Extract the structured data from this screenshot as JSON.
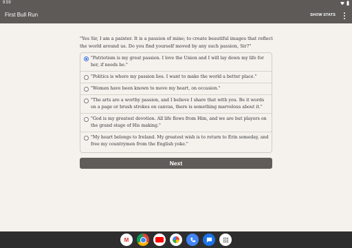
{
  "status_bar": {
    "time": "9:59"
  },
  "app_bar": {
    "title": "First Bull Run",
    "stats_label": "SHOW STATS"
  },
  "passage": "\"Yes Sir, I am a painter. It is a passion of mine; to create beautiful images that reflect the world around us. Do you find yourself moved by any such passion, Sir?\"",
  "choices": [
    {
      "text": "\"Patriotism is my great passion. I love the Union and I will lay down my life for her, if needs be.\"",
      "selected": true
    },
    {
      "text": "\"Politics is where my passion lies. I want to make the world a better place.\"",
      "selected": false
    },
    {
      "text": "\"Women have been known to move my heart, on occasion.\"",
      "selected": false
    },
    {
      "text": "\"The arts are a worthy passion, and I believe I share that with you. Be it words on a page or brush strokes on canvas, there is something marvelous about it.\"",
      "selected": false
    },
    {
      "text": "\"God is my greatest devotion. All life flows from Him, and we are but players on the grand stage of His making.\"",
      "selected": false
    },
    {
      "text": "\"My heart belongs to Ireland. My greatest wish is to return to Erin someday, and free my countrymen from the English yoke.\"",
      "selected": false
    }
  ],
  "next_label": "Next",
  "dock": [
    "gmail-icon",
    "chrome-icon",
    "youtube-icon",
    "photos-icon",
    "phone-icon",
    "messages-icon",
    "app-launcher-icon"
  ]
}
